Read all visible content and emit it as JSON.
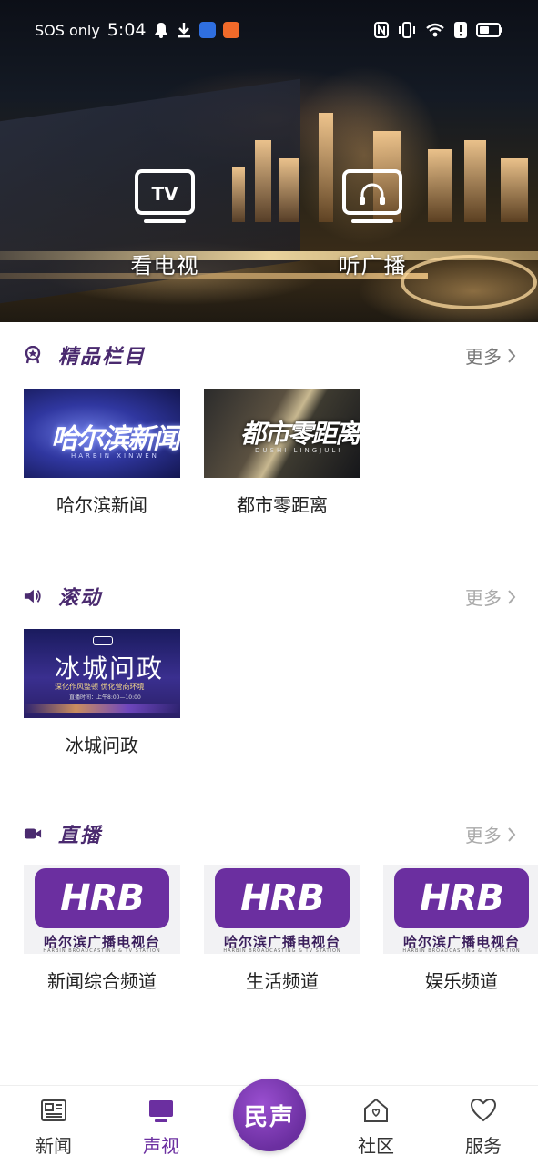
{
  "status_bar": {
    "carrier": "SOS only",
    "time": "5:04"
  },
  "hero": {
    "tv_label": "看电视",
    "radio_label": "听广播",
    "tv_icon_text": "TV"
  },
  "sections": {
    "featured": {
      "title": "精品栏目",
      "more": "更多",
      "items": [
        {
          "caption": "哈尔滨新闻",
          "thumb_title": "哈尔滨新闻",
          "thumb_sub": "HARBIN XINWEN"
        },
        {
          "caption": "都市零距离",
          "thumb_title": "都市零距离",
          "thumb_sub": "DUSHI LINGJULI"
        }
      ]
    },
    "rolling": {
      "title": "滚动",
      "more": "更多",
      "items": [
        {
          "caption": "冰城问政",
          "thumb_title": "冰城问政",
          "thumb_sub": "深化作风整顿  优化营商环境",
          "thumb_sub2": "直播时间：上午8:00—10:00"
        }
      ]
    },
    "live": {
      "title": "直播",
      "more": "更多",
      "items": [
        {
          "caption": "新闻综合频道"
        },
        {
          "caption": "生活频道"
        },
        {
          "caption": "娱乐频道"
        }
      ],
      "logo_text": "HRB",
      "logo_name": "哈尔滨广播电视台",
      "logo_sub": "HARBIN BROADCASTING & TV STATION"
    }
  },
  "bottom_nav": {
    "items": [
      {
        "label": "新闻"
      },
      {
        "label": "声视"
      },
      {
        "label": "社区"
      },
      {
        "label": "服务"
      }
    ],
    "center_label": "民声"
  },
  "colors": {
    "accent": "#6b2fa0",
    "section_title": "#4a2a6f"
  }
}
